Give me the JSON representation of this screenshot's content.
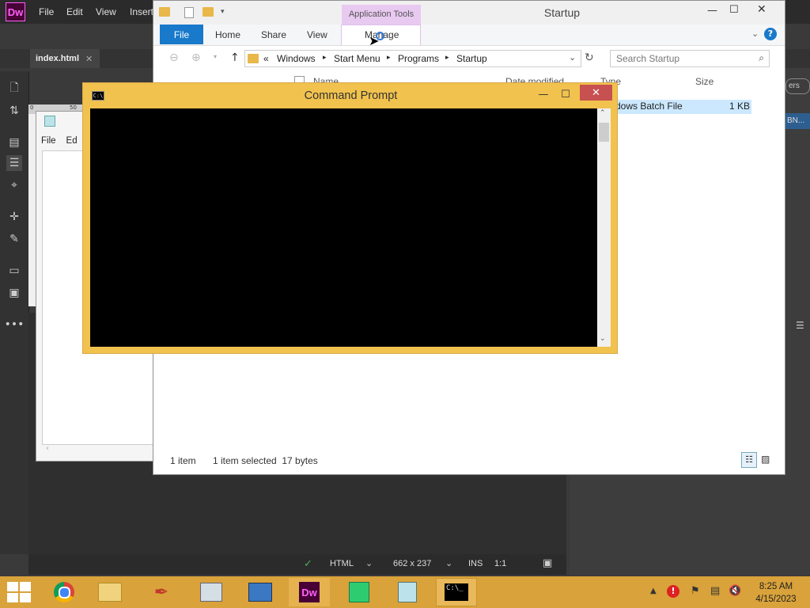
{
  "dreamweaver": {
    "logo": "Dw",
    "menu": [
      "File",
      "Edit",
      "View",
      "Insert"
    ],
    "doc_tab": "index.html",
    "ruler_marks": [
      "0",
      "50"
    ],
    "status": {
      "doc_type": "HTML",
      "dimensions": "662 x 237",
      "mode": "INS",
      "zoom": "1:1"
    },
    "right_panel_text": [
      "ers",
      "BN..."
    ]
  },
  "notepad": {
    "menu": [
      "File",
      "Ed"
    ]
  },
  "explorer": {
    "title": "Startup",
    "app_tools": "Application Tools",
    "ribbon_tabs": {
      "file": "File",
      "home": "Home",
      "share": "Share",
      "view": "View",
      "manage": "Manage"
    },
    "breadcrumb": [
      "Windows",
      "Start Menu",
      "Programs",
      "Startup"
    ],
    "breadcrumb_prefix": "«",
    "search_placeholder": "Search Startup",
    "columns": {
      "name": "Name",
      "date": "Date modified",
      "type": "Type",
      "size": "Size"
    },
    "file_row": {
      "type": "dows Batch File",
      "size": "1 KB"
    },
    "status": {
      "count": "1 item",
      "selected": "1 item selected  17 bytes"
    }
  },
  "cmd": {
    "title": "Command Prompt",
    "icon_text": "C:\\"
  },
  "taskbar": {
    "time": "8:25 AM",
    "date": "4/15/2023"
  },
  "colors": {
    "accent": "#1979ca",
    "cmd_frame": "#f1c24d",
    "taskbar": "#d9a23a",
    "close": "#c75050",
    "dw_brand": "#ff61f6"
  }
}
